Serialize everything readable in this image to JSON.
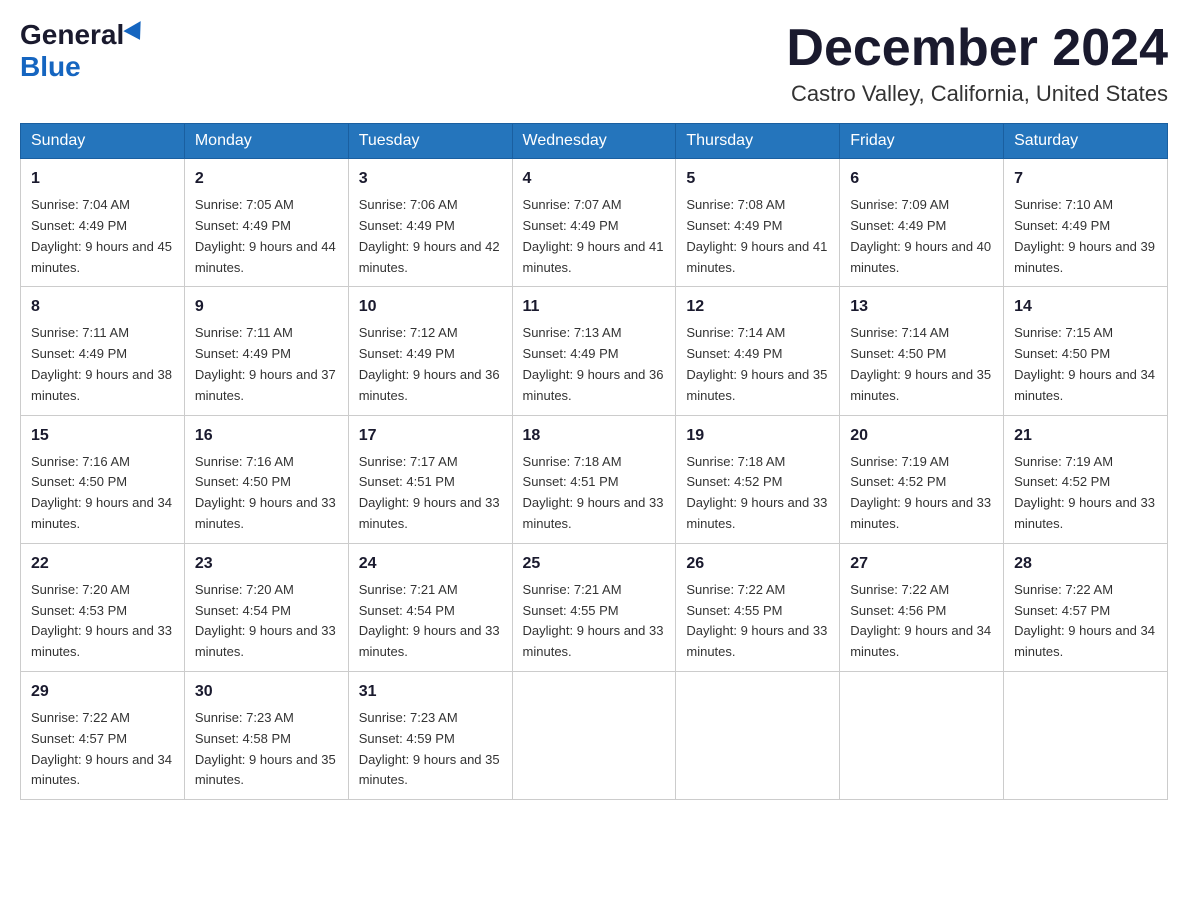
{
  "header": {
    "logo_general": "General",
    "logo_blue": "Blue",
    "month_title": "December 2024",
    "location": "Castro Valley, California, United States"
  },
  "days_of_week": [
    "Sunday",
    "Monday",
    "Tuesday",
    "Wednesday",
    "Thursday",
    "Friday",
    "Saturday"
  ],
  "weeks": [
    [
      {
        "day": "1",
        "sunrise": "7:04 AM",
        "sunset": "4:49 PM",
        "daylight": "9 hours and 45 minutes."
      },
      {
        "day": "2",
        "sunrise": "7:05 AM",
        "sunset": "4:49 PM",
        "daylight": "9 hours and 44 minutes."
      },
      {
        "day": "3",
        "sunrise": "7:06 AM",
        "sunset": "4:49 PM",
        "daylight": "9 hours and 42 minutes."
      },
      {
        "day": "4",
        "sunrise": "7:07 AM",
        "sunset": "4:49 PM",
        "daylight": "9 hours and 41 minutes."
      },
      {
        "day": "5",
        "sunrise": "7:08 AM",
        "sunset": "4:49 PM",
        "daylight": "9 hours and 41 minutes."
      },
      {
        "day": "6",
        "sunrise": "7:09 AM",
        "sunset": "4:49 PM",
        "daylight": "9 hours and 40 minutes."
      },
      {
        "day": "7",
        "sunrise": "7:10 AM",
        "sunset": "4:49 PM",
        "daylight": "9 hours and 39 minutes."
      }
    ],
    [
      {
        "day": "8",
        "sunrise": "7:11 AM",
        "sunset": "4:49 PM",
        "daylight": "9 hours and 38 minutes."
      },
      {
        "day": "9",
        "sunrise": "7:11 AM",
        "sunset": "4:49 PM",
        "daylight": "9 hours and 37 minutes."
      },
      {
        "day": "10",
        "sunrise": "7:12 AM",
        "sunset": "4:49 PM",
        "daylight": "9 hours and 36 minutes."
      },
      {
        "day": "11",
        "sunrise": "7:13 AM",
        "sunset": "4:49 PM",
        "daylight": "9 hours and 36 minutes."
      },
      {
        "day": "12",
        "sunrise": "7:14 AM",
        "sunset": "4:49 PM",
        "daylight": "9 hours and 35 minutes."
      },
      {
        "day": "13",
        "sunrise": "7:14 AM",
        "sunset": "4:50 PM",
        "daylight": "9 hours and 35 minutes."
      },
      {
        "day": "14",
        "sunrise": "7:15 AM",
        "sunset": "4:50 PM",
        "daylight": "9 hours and 34 minutes."
      }
    ],
    [
      {
        "day": "15",
        "sunrise": "7:16 AM",
        "sunset": "4:50 PM",
        "daylight": "9 hours and 34 minutes."
      },
      {
        "day": "16",
        "sunrise": "7:16 AM",
        "sunset": "4:50 PM",
        "daylight": "9 hours and 33 minutes."
      },
      {
        "day": "17",
        "sunrise": "7:17 AM",
        "sunset": "4:51 PM",
        "daylight": "9 hours and 33 minutes."
      },
      {
        "day": "18",
        "sunrise": "7:18 AM",
        "sunset": "4:51 PM",
        "daylight": "9 hours and 33 minutes."
      },
      {
        "day": "19",
        "sunrise": "7:18 AM",
        "sunset": "4:52 PM",
        "daylight": "9 hours and 33 minutes."
      },
      {
        "day": "20",
        "sunrise": "7:19 AM",
        "sunset": "4:52 PM",
        "daylight": "9 hours and 33 minutes."
      },
      {
        "day": "21",
        "sunrise": "7:19 AM",
        "sunset": "4:52 PM",
        "daylight": "9 hours and 33 minutes."
      }
    ],
    [
      {
        "day": "22",
        "sunrise": "7:20 AM",
        "sunset": "4:53 PM",
        "daylight": "9 hours and 33 minutes."
      },
      {
        "day": "23",
        "sunrise": "7:20 AM",
        "sunset": "4:54 PM",
        "daylight": "9 hours and 33 minutes."
      },
      {
        "day": "24",
        "sunrise": "7:21 AM",
        "sunset": "4:54 PM",
        "daylight": "9 hours and 33 minutes."
      },
      {
        "day": "25",
        "sunrise": "7:21 AM",
        "sunset": "4:55 PM",
        "daylight": "9 hours and 33 minutes."
      },
      {
        "day": "26",
        "sunrise": "7:22 AM",
        "sunset": "4:55 PM",
        "daylight": "9 hours and 33 minutes."
      },
      {
        "day": "27",
        "sunrise": "7:22 AM",
        "sunset": "4:56 PM",
        "daylight": "9 hours and 34 minutes."
      },
      {
        "day": "28",
        "sunrise": "7:22 AM",
        "sunset": "4:57 PM",
        "daylight": "9 hours and 34 minutes."
      }
    ],
    [
      {
        "day": "29",
        "sunrise": "7:22 AM",
        "sunset": "4:57 PM",
        "daylight": "9 hours and 34 minutes."
      },
      {
        "day": "30",
        "sunrise": "7:23 AM",
        "sunset": "4:58 PM",
        "daylight": "9 hours and 35 minutes."
      },
      {
        "day": "31",
        "sunrise": "7:23 AM",
        "sunset": "4:59 PM",
        "daylight": "9 hours and 35 minutes."
      },
      null,
      null,
      null,
      null
    ]
  ],
  "labels": {
    "sunrise_prefix": "Sunrise: ",
    "sunset_prefix": "Sunset: ",
    "daylight_prefix": "Daylight: "
  }
}
